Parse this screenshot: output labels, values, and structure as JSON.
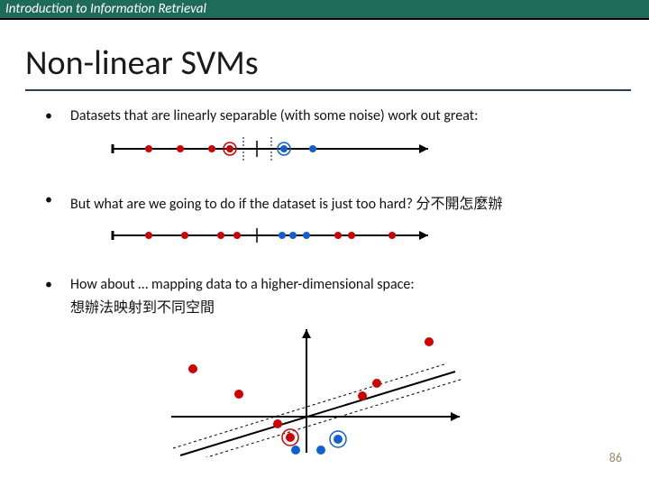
{
  "header": {
    "course": "Introduction to Information Retrieval"
  },
  "title": "Non-linear SVMs",
  "bullets": [
    "Datasets that are linearly separable (with some noise) work out great:",
    "But what are we going to do if the dataset is just too hard?  分不開怎麼辦",
    "How about … mapping data to a higher-dimensional space:"
  ],
  "extra_line": "想辦法映射到不同空間",
  "page_number": "86",
  "chart_data": [
    {
      "type": "scatter",
      "title": "linearly-separable-1d",
      "x": [
        0.1,
        0.2,
        0.3,
        0.36,
        0.55,
        0.64
      ],
      "class": [
        "r",
        "r",
        "r",
        "r",
        "b",
        "b"
      ],
      "support_x": [
        0.36,
        0.55
      ],
      "margin_x": [
        0.4,
        0.5
      ],
      "axis_range": [
        0,
        1
      ]
    },
    {
      "type": "scatter",
      "title": "non-separable-1d",
      "x": [
        0.1,
        0.22,
        0.34,
        0.38,
        0.53,
        0.56,
        0.6,
        0.7,
        0.74,
        0.87
      ],
      "class": [
        "r",
        "r",
        "r",
        "r",
        "b",
        "b",
        "b",
        "r",
        "r",
        "r"
      ],
      "axis_range": [
        0,
        1
      ]
    },
    {
      "type": "scatter",
      "title": "mapped-2d",
      "series": [
        {
          "name": "red",
          "points": [
            [
              -2.3,
              0.8
            ],
            [
              -1.4,
              0.35
            ],
            [
              -0.6,
              -0.2
            ],
            [
              -0.35,
              -0.55
            ],
            [
              1.0,
              0.3
            ],
            [
              1.2,
              0.5
            ],
            [
              2.2,
              1.2
            ]
          ]
        },
        {
          "name": "blue",
          "points": [
            [
              -0.3,
              -0.75
            ],
            [
              0.25,
              -0.75
            ],
            [
              0.5,
              -0.55
            ]
          ]
        }
      ],
      "support_points": [
        [
          -0.35,
          -0.55
        ],
        [
          0.5,
          -0.55
        ]
      ],
      "separator_line": {
        "slope": 0.35,
        "intercept": -0.45
      },
      "xlim": [
        -2.8,
        2.8
      ],
      "ylim": [
        -1.2,
        1.4
      ]
    }
  ]
}
